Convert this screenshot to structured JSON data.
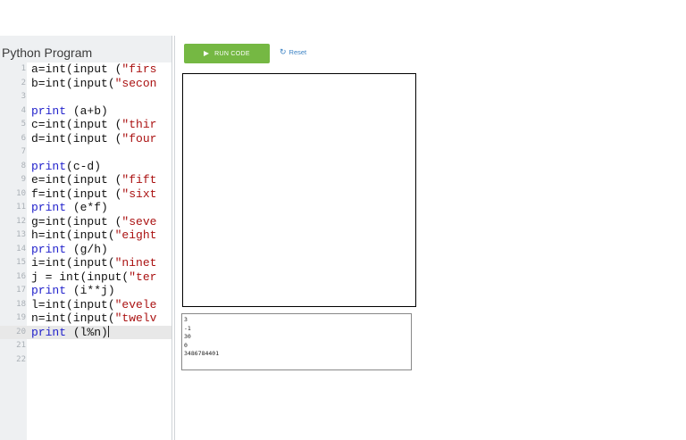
{
  "editor": {
    "title": "Python Program",
    "lines": [
      {
        "num": "1",
        "parts": [
          [
            "t",
            "a=int(input ("
          ],
          [
            "s",
            "\"firs"
          ]
        ]
      },
      {
        "num": "2",
        "parts": [
          [
            "t",
            "b=int(input("
          ],
          [
            "s",
            "\"secon"
          ]
        ]
      },
      {
        "num": "3",
        "parts": []
      },
      {
        "num": "4",
        "parts": [
          [
            "k",
            "print"
          ],
          [
            "t",
            " (a+b)"
          ]
        ]
      },
      {
        "num": "5",
        "parts": [
          [
            "t",
            "c=int(input ("
          ],
          [
            "s",
            "\"thir"
          ]
        ]
      },
      {
        "num": "6",
        "parts": [
          [
            "t",
            "d=int(input ("
          ],
          [
            "s",
            "\"four"
          ]
        ]
      },
      {
        "num": "7",
        "parts": []
      },
      {
        "num": "8",
        "parts": [
          [
            "k",
            "print"
          ],
          [
            "t",
            "(c-d)"
          ]
        ]
      },
      {
        "num": "9",
        "parts": [
          [
            "t",
            "e=int(input ("
          ],
          [
            "s",
            "\"fift"
          ]
        ]
      },
      {
        "num": "10",
        "parts": [
          [
            "t",
            "f=int(input ("
          ],
          [
            "s",
            "\"sixt"
          ]
        ]
      },
      {
        "num": "11",
        "parts": [
          [
            "k",
            "print"
          ],
          [
            "t",
            " (e*f)"
          ]
        ]
      },
      {
        "num": "12",
        "parts": [
          [
            "t",
            "g=int(input ("
          ],
          [
            "s",
            "\"seve"
          ]
        ]
      },
      {
        "num": "13",
        "parts": [
          [
            "t",
            "h=int(input("
          ],
          [
            "s",
            "\"eight"
          ]
        ]
      },
      {
        "num": "14",
        "parts": [
          [
            "k",
            "print"
          ],
          [
            "t",
            " (g/h)"
          ]
        ]
      },
      {
        "num": "15",
        "parts": [
          [
            "t",
            "i=int(input("
          ],
          [
            "s",
            "\"ninet"
          ]
        ]
      },
      {
        "num": "16",
        "parts": [
          [
            "t",
            "j = int(input("
          ],
          [
            "s",
            "\"ter"
          ]
        ]
      },
      {
        "num": "17",
        "parts": [
          [
            "k",
            "print"
          ],
          [
            "t",
            " (i**j)"
          ]
        ]
      },
      {
        "num": "18",
        "parts": [
          [
            "t",
            "l=int(input("
          ],
          [
            "s",
            "\"evele"
          ]
        ]
      },
      {
        "num": "19",
        "parts": [
          [
            "t",
            "n=int(input("
          ],
          [
            "s",
            "\"twelv"
          ]
        ]
      },
      {
        "num": "20",
        "parts": [
          [
            "k",
            "print"
          ],
          [
            "t",
            " (l%n)"
          ]
        ],
        "active": true
      },
      {
        "num": "21",
        "parts": []
      },
      {
        "num": "22",
        "parts": []
      }
    ]
  },
  "toolbar": {
    "run_label": "RUN CODE",
    "reset_label": "Reset"
  },
  "console": {
    "output": [
      "3",
      "-1",
      "30",
      "0",
      "3486784401"
    ]
  },
  "colors": {
    "run_button": "#75b843",
    "reset_link": "#3b82c4",
    "keyword": "#2222cc",
    "string": "#a11111"
  }
}
